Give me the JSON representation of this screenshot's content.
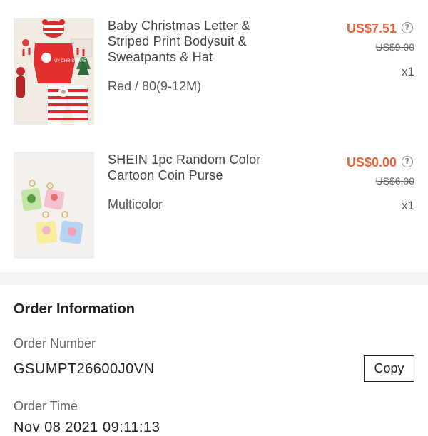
{
  "products": [
    {
      "name": "Baby Christmas Letter & Striped Print Bodysuit & Sweatpants & Hat",
      "variant": "Red / 80(9-12M)",
      "price": "US$7.51",
      "original_price": "US$9.00",
      "quantity": "x1",
      "image_text": "MY CHRISTMAS"
    },
    {
      "name": "SHEIN 1pc Random Color Cartoon Coin Purse",
      "variant": "Multicolor",
      "price": "US$0.00",
      "original_price": "US$6.00",
      "quantity": "x1"
    }
  ],
  "order_info": {
    "title": "Order Information",
    "order_number_label": "Order Number",
    "order_number": "GSUMPT26600J0VN",
    "copy_label": "Copy",
    "order_time_label": "Order Time",
    "order_time": "Nov 08 2021 09:11:13"
  },
  "icons": {
    "price_help": "question-circle-icon"
  },
  "colors": {
    "price_accent": "#e8633a",
    "text_primary": "#222222",
    "text_secondary": "#666666",
    "divider_band": "#f5f5f5"
  }
}
